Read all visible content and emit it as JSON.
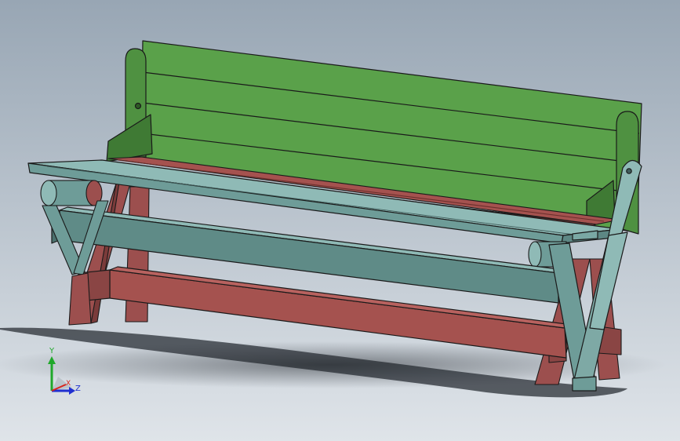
{
  "viewport": {
    "background_top": "#98a6b4",
    "background_bottom": "#dfe4e9"
  },
  "model": {
    "colors": {
      "backrest": "#5aa14a",
      "backrest_dark": "#3f7a34",
      "seat_red": "#a5524f",
      "frame_teal": "#6e9c98",
      "frame_teal_dark": "#4f7572",
      "legs_red": "#9c4f4e",
      "edge": "#1a1a1a"
    }
  },
  "triad": {
    "y_label": "Y",
    "x_label": "X",
    "z_label": "Z",
    "y_color": "#1fa82a",
    "x_color": "#d8261c",
    "z_color": "#1f2fd0"
  }
}
